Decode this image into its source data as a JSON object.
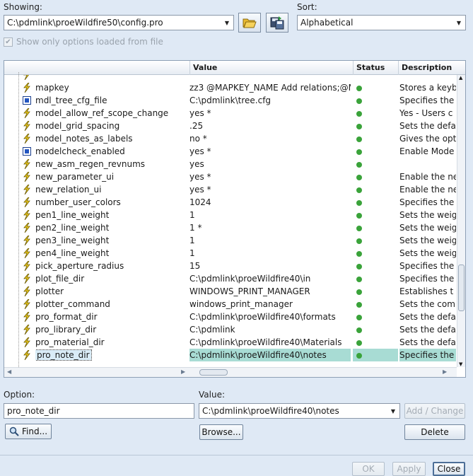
{
  "showing": {
    "label": "Showing:",
    "value": "C:\\pdmlink\\proeWildfire50\\config.pro"
  },
  "sort": {
    "label": "Sort:",
    "value": "Alphabetical"
  },
  "icons": {
    "open": "folder-open-icon",
    "save": "save-config-icon"
  },
  "show_loaded_checkbox": {
    "label": "Show only options loaded from file",
    "checked": true
  },
  "table": {
    "columns": [
      "Value",
      "Status",
      "Description"
    ],
    "rows": [
      {
        "icon": "bolt",
        "name": "mapkey",
        "value": "zz3 @MAPKEY_NAME Add relations;@M...",
        "status": "dot",
        "desc": "Stores a keyb"
      },
      {
        "icon": "square",
        "name": "mdl_tree_cfg_file",
        "value": "C:\\pdmlink\\tree.cfg",
        "status": "dot",
        "desc": "Specifies the"
      },
      {
        "icon": "bolt",
        "name": "model_allow_ref_scope_change",
        "value": "yes *",
        "status": "dot",
        "desc": "Yes - Users c"
      },
      {
        "icon": "bolt",
        "name": "model_grid_spacing",
        "value": ".25",
        "status": "dot",
        "desc": "Sets the defa"
      },
      {
        "icon": "bolt",
        "name": "model_notes_as_labels",
        "value": "no *",
        "status": "dot",
        "desc": "Gives the opt"
      },
      {
        "icon": "square",
        "name": "modelcheck_enabled",
        "value": "yes *",
        "status": "dot",
        "desc": "Enable Mode"
      },
      {
        "icon": "bolt",
        "name": "new_asm_regen_revnums",
        "value": "yes",
        "status": "dot",
        "desc": ""
      },
      {
        "icon": "bolt",
        "name": "new_parameter_ui",
        "value": "yes *",
        "status": "dot",
        "desc": "Enable the ne"
      },
      {
        "icon": "bolt",
        "name": "new_relation_ui",
        "value": "yes *",
        "status": "dot",
        "desc": "Enable the ne"
      },
      {
        "icon": "bolt",
        "name": "number_user_colors",
        "value": "1024",
        "status": "dot",
        "desc": "Specifies the"
      },
      {
        "icon": "bolt",
        "name": "pen1_line_weight",
        "value": "1",
        "status": "dot",
        "desc": "Sets the weig"
      },
      {
        "icon": "bolt",
        "name": "pen2_line_weight",
        "value": "1 *",
        "status": "dot",
        "desc": "Sets the weig"
      },
      {
        "icon": "bolt",
        "name": "pen3_line_weight",
        "value": "1",
        "status": "dot",
        "desc": "Sets the weig"
      },
      {
        "icon": "bolt",
        "name": "pen4_line_weight",
        "value": "1",
        "status": "dot",
        "desc": "Sets the weig"
      },
      {
        "icon": "bolt",
        "name": "pick_aperture_radius",
        "value": "15",
        "status": "dot",
        "desc": "Specifies the"
      },
      {
        "icon": "bolt",
        "name": "plot_file_dir",
        "value": "C:\\pdmlink\\proeWildfire40\\in",
        "status": "dot",
        "desc": "Specifies the"
      },
      {
        "icon": "bolt",
        "name": "plotter",
        "value": "WINDOWS_PRINT_MANAGER",
        "status": "dot",
        "desc": "Establishes t"
      },
      {
        "icon": "bolt",
        "name": "plotter_command",
        "value": "windows_print_manager",
        "status": "dot",
        "desc": "Sets the com"
      },
      {
        "icon": "bolt",
        "name": "pro_format_dir",
        "value": "C:\\pdmlink\\proeWildfire40\\formats",
        "status": "dot",
        "desc": "Sets the defa"
      },
      {
        "icon": "bolt",
        "name": "pro_library_dir",
        "value": "C:\\pdmlink",
        "status": "dot",
        "desc": "Sets the defa"
      },
      {
        "icon": "bolt",
        "name": "pro_material_dir",
        "value": "C:\\pdmlink\\proeWildfire40\\Materials",
        "status": "dot",
        "desc": "Sets the defa"
      },
      {
        "icon": "bolt",
        "name": "pro_note_dir",
        "value": "C:\\pdmlink\\proeWildfire40\\notes",
        "status": "dot",
        "desc": "Specifies the",
        "selected": true
      }
    ]
  },
  "option": {
    "label": "Option:",
    "value": "pro_note_dir"
  },
  "value": {
    "label": "Value:",
    "value": "C:\\pdmlink\\proeWildfire40\\notes"
  },
  "buttons": {
    "add_change": "Add / Change",
    "find": "Find...",
    "browse": "Browse...",
    "delete": "Delete",
    "ok": "OK",
    "apply": "Apply",
    "close": "Close"
  },
  "colors": {
    "accent_selection": "#a8dcd4",
    "status_ok": "#3aa33a",
    "background": "#dfe9f5"
  }
}
